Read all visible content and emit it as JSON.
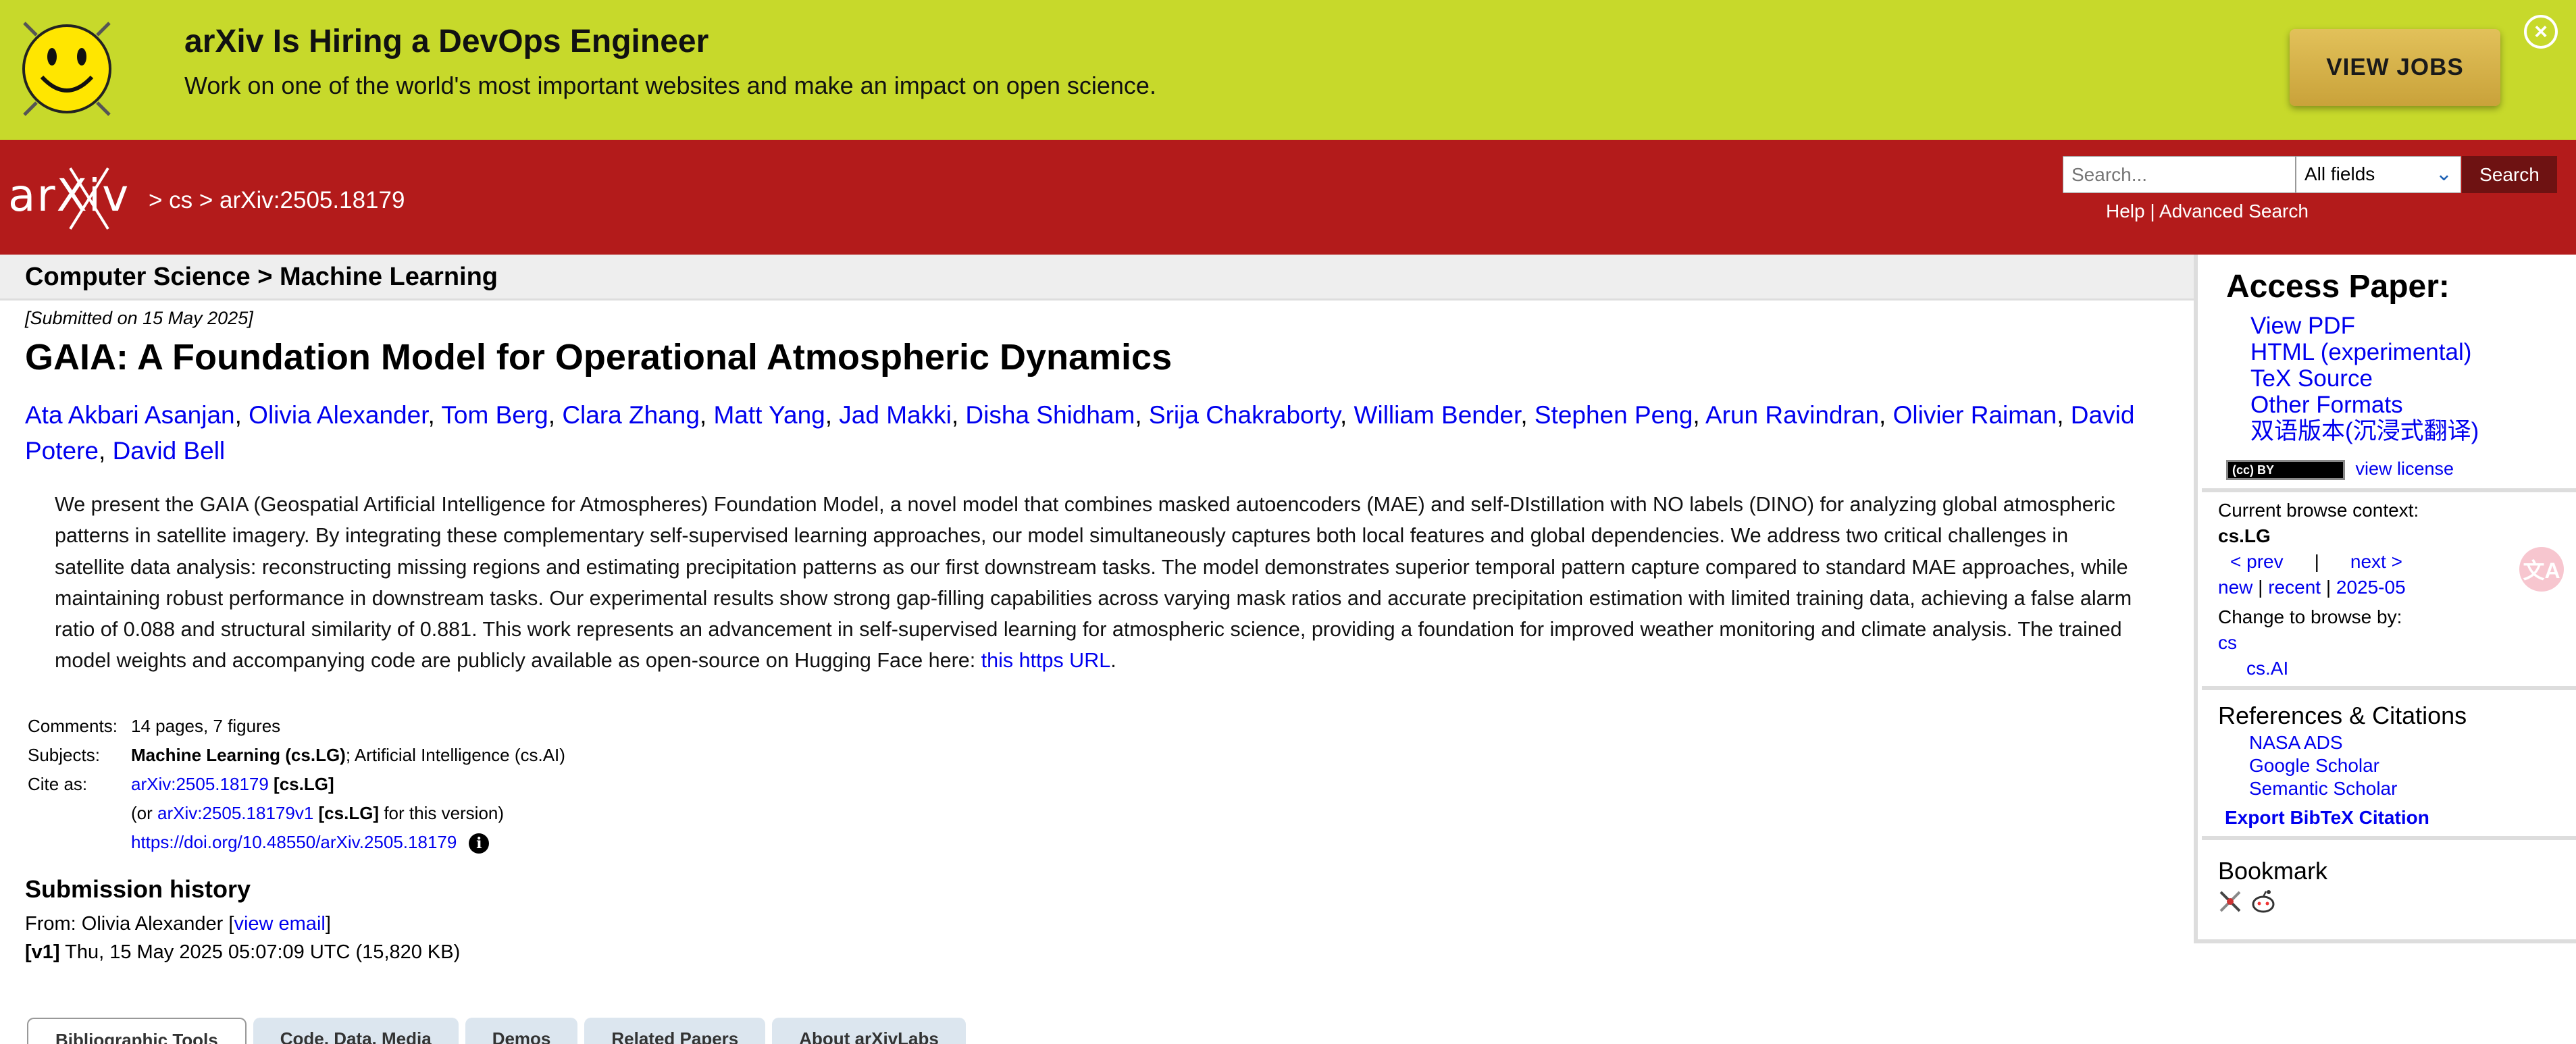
{
  "banner": {
    "title": "arXiv Is Hiring a DevOps Engineer",
    "subtitle": "Work on one of the world's most important websites and make an impact on open science.",
    "button": "VIEW JOBS",
    "close": "×"
  },
  "header": {
    "breadcrumb": "> cs > arXiv:2505.18179",
    "search_placeholder": "Search...",
    "search_field": "All fields",
    "search_button": "Search",
    "help": "Help",
    "separator": " | ",
    "advanced": "Advanced Search"
  },
  "subheader": "Computer Science > Machine Learning",
  "paper": {
    "submitted": "[Submitted on 15 May 2025]",
    "title": "GAIA: A Foundation Model for Operational Atmospheric Dynamics",
    "authors": [
      "Ata Akbari Asanjan",
      "Olivia Alexander",
      "Tom Berg",
      "Clara Zhang",
      "Matt Yang",
      "Jad Makki",
      "Disha Shidham",
      "Srija Chakraborty",
      "William Bender",
      "Stephen Peng",
      "Arun Ravindran",
      "Olivier Raiman",
      "David Potere",
      "David Bell"
    ],
    "abstract": "We present the GAIA (Geospatial Artificial Intelligence for Atmospheres) Foundation Model, a novel model that combines masked autoencoders (MAE) and self-DIstillation with NO labels (DINO) for analyzing global atmospheric patterns in satellite imagery. By integrating these complementary self-supervised learning approaches, our model simultaneously captures both local features and global dependencies. We address two critical challenges in satellite data analysis: reconstructing missing regions and estimating precipitation patterns as our first downstream tasks. The model demonstrates superior temporal pattern capture compared to standard MAE approaches, while maintaining robust performance in downstream tasks. Our experimental results show strong gap-filling capabilities across varying mask ratios and accurate precipitation estimation with limited training data, achieving a false alarm ratio of 0.088 and structural similarity of 0.881. This work represents an advancement in self-supervised learning for atmospheric science, providing a foundation for improved weather monitoring and climate analysis. The trained model weights and accompanying code are publicly available as open-source on Hugging Face here: ",
    "abstract_link": "this https URL",
    "abstract_end": "."
  },
  "meta": {
    "comments_label": "Comments:",
    "comments": "14 pages, 7 figures",
    "subjects_label": "Subjects:",
    "subject_primary": "Machine Learning (cs.LG)",
    "subject_rest": "; Artificial Intelligence (cs.AI)",
    "cite_label": "Cite as:",
    "cite_id": "arXiv:2505.18179",
    "cite_cat": " [cs.LG]",
    "cite_or": "(or ",
    "cite_version": "arXiv:2505.18179v1",
    "cite_version_cat": " [cs.LG]",
    "cite_version_tail": " for this version)",
    "doi": "https://doi.org/10.48550/arXiv.2505.18179",
    "info_icon": "i"
  },
  "history": {
    "title": "Submission history",
    "from": "From: Olivia Alexander [",
    "view_email": "view email",
    "from_end": "]",
    "v1_label": "[v1]",
    "v1_text": " Thu, 15 May 2025 05:07:09 UTC (15,820 KB)"
  },
  "tabs": [
    "Bibliographic Tools",
    "Code, Data, Media",
    "Demos",
    "Related Papers",
    "About arXivLabs"
  ],
  "sidebar": {
    "access_title": "Access Paper:",
    "access_links": [
      "View PDF",
      "HTML (experimental)",
      "TeX Source",
      "Other Formats",
      "双语版本(沉浸式翻译)"
    ],
    "cc_badge": "(cc) BY",
    "license": "view license",
    "context_label": "Current browse context:",
    "context_value": "cs.LG",
    "prev": "< prev",
    "pipe": "|",
    "next": "next >",
    "new": "new",
    "recent": "recent",
    "month": "2025-05",
    "change_label": "Change to browse by:",
    "cs": "cs",
    "cs_ai": "cs.AI",
    "refs_title": "References & Citations",
    "refs": [
      "NASA ADS",
      "Google Scholar",
      "Semantic Scholar"
    ],
    "bibtex": "Export BibTeX Citation",
    "bookmark": "Bookmark"
  },
  "translate_fab": "文A"
}
